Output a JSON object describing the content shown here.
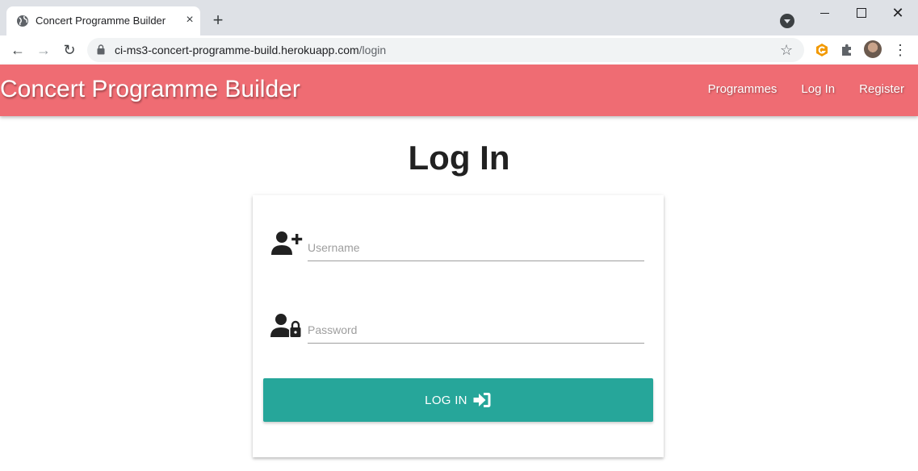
{
  "browser": {
    "tab_title": "Concert Programme Builder",
    "tab_close": "×",
    "new_tab": "+",
    "url_host": "ci-ms3-concert-programme-build.herokuapp.com",
    "url_path": "/login",
    "back": "←",
    "forward": "→",
    "reload": "↻",
    "star": "☆",
    "menu": "⋮",
    "close_window": "✕"
  },
  "site": {
    "brand": "Concert Programme Builder",
    "nav": [
      {
        "label": "Programmes"
      },
      {
        "label": "Log In"
      },
      {
        "label": "Register"
      }
    ]
  },
  "main": {
    "title": "Log In",
    "form": {
      "username": {
        "placeholder": "Username",
        "value": "",
        "icon": "user-plus-icon"
      },
      "password": {
        "placeholder": "Password",
        "value": "",
        "icon": "user-lock-icon"
      },
      "submit_label": "LOG IN",
      "submit_icon": "sign-in-icon"
    }
  },
  "colors": {
    "navbar": "#ef6c73",
    "button": "#26a69a",
    "chrome": "#dee1e6"
  }
}
